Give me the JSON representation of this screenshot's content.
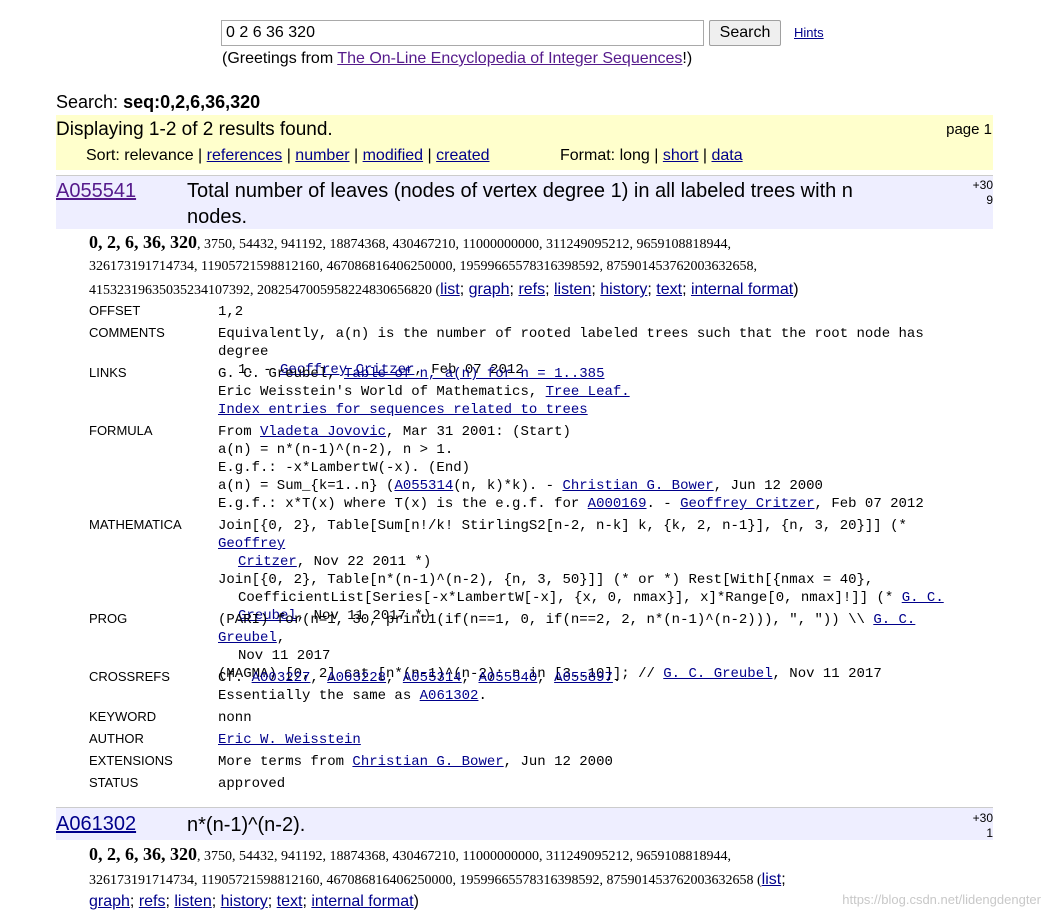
{
  "search": {
    "value": "0 2 6 36 320",
    "button": "Search",
    "hints": "Hints",
    "greeting_pre": "(Greetings from ",
    "greeting_link": "The On-Line Encyclopedia of Integer Sequences",
    "greeting_post": "!)"
  },
  "query": {
    "label": "Search:",
    "term": "seq:0,2,6,36,320"
  },
  "results": {
    "summary": "Displaying 1-2 of 2 results found.",
    "page": "page 1",
    "sort_label": "Sort: relevance",
    "sort_links": [
      "references",
      "number",
      "modified",
      "created"
    ],
    "format_label": "Format: long",
    "format_links": [
      "short",
      "data"
    ]
  },
  "seq_links": [
    "list",
    "graph",
    "refs",
    "listen",
    "history",
    "text",
    "internal format"
  ],
  "seq1": {
    "id": "A055541",
    "title": "Total number of leaves (nodes of vertex degree 1) in all labeled trees with n nodes.",
    "votes_top": "+30",
    "votes_bottom": "9",
    "first_terms": "0, 2, 6, 36, 320",
    "terms_rest1": ", 3750, 54432, 941192, 18874368, 430467210, 11000000000, 311249095212, 9659108818944,",
    "terms_rest2": "326173191714734, 11905721598812160, 467086816406250000, 19599665578316398592, 875901453762003632658,",
    "terms_rest3": "41532319635035234107392, 2082547005958224830656820 (",
    "offset_label": "OFFSET",
    "offset": "1,2",
    "comments_label": "COMMENTS",
    "comments_l1": "Equivalently, a(n) is the number of rooted labeled trees such that the root node has degree",
    "comments_l2": "1. - ",
    "comments_author": "Geoffrey Critzer",
    "comments_date": ", Feb 07 2012",
    "links_label": "LINKS",
    "links_l1_pre": "G. C. Greubel, ",
    "links_l1_link": "Table of n, a(n) for n = 1..385",
    "links_l2_pre": "Eric Weisstein's World of Mathematics, ",
    "links_l2_link": "Tree Leaf.",
    "links_l3_link": "Index entries for sequences related to trees",
    "formula_label": "FORMULA",
    "formula_l1_pre": "From ",
    "formula_l1_author": "Vladeta Jovovic",
    "formula_l1_post": ", Mar 31 2001: (Start)",
    "formula_l2": "a(n) = n*(n-1)^(n-2), n > 1.",
    "formula_l3": "E.g.f.: -x*LambertW(-x). (End)",
    "formula_l4_pre": "a(n) = Sum_{k=1..n} (",
    "formula_l4_link": "A055314",
    "formula_l4_mid": "(n, k)*k). - ",
    "formula_l4_author": "Christian G. Bower",
    "formula_l4_post": ", Jun 12 2000",
    "formula_l5_pre": "E.g.f.: x*T(x) where T(x) is the e.g.f. for ",
    "formula_l5_link": "A000169",
    "formula_l5_mid": ". - ",
    "formula_l5_author": "Geoffrey Critzer",
    "formula_l5_post": ", Feb 07 2012",
    "math_label": "MATHEMATICA",
    "math_l1": "Join[{0, 2}, Table[Sum[n!/k! StirlingS2[n-2, n-k] k, {k, 2, n-1}], {n, 3, 20}]] (* ",
    "math_l1_author": "Geoffrey",
    "math_l2_author": "Critzer",
    "math_l2_post": ", Nov 22 2011 *)",
    "math_l3": "Join[{0, 2}, Table[n*(n-1)^(n-2), {n, 3, 50}]] (* or *) Rest[With[{nmax = 40},",
    "math_l4": "CoefficientList[Series[-x*LambertW[-x], {x, 0, nmax}], x]*Range[0, nmax]!]] (* ",
    "math_l4_author": "G. C.",
    "math_l5_author": "Greubel",
    "math_l5_post": ", Nov 11 2017 *)",
    "prog_label": "PROG",
    "prog_l1": "(PARI) for(n=1, 30, print1(if(n==1, 0, if(n==2, 2, n*(n-1)^(n-2))), \", \")) \\\\ ",
    "prog_l1_author": "G. C. Greubel",
    "prog_l1_post": ",",
    "prog_l2": "Nov 11 2017",
    "prog_l3": "(MAGMA) [0, 2] cat [n*(n-1)^(n-2): n in [3..10]]; // ",
    "prog_l3_author": "G. C. Greubel",
    "prog_l3_post": ", Nov 11 2017",
    "xref_label": "CROSSREFS",
    "xref_pre": "Cf. ",
    "xref_links": [
      "A003227",
      "A003228",
      "A055314",
      "A055540",
      "A055897"
    ],
    "xref_l2_pre": "Essentially the same as ",
    "xref_l2_link": "A061302",
    "keyword_label": "KEYWORD",
    "keyword": "nonn",
    "author_label": "AUTHOR",
    "author": "Eric W. Weisstein",
    "ext_label": "EXTENSIONS",
    "ext_pre": "More terms from ",
    "ext_author": "Christian G. Bower",
    "ext_post": ", Jun 12 2000",
    "status_label": "STATUS",
    "status": "approved"
  },
  "seq2": {
    "id": "A061302",
    "title": "n*(n-1)^(n-2).",
    "votes_top": "+30",
    "votes_bottom": "1",
    "first_terms": "0, 2, 6, 36, 320",
    "terms_rest1": ", 3750, 54432, 941192, 18874368, 430467210, 11000000000, 311249095212, 9659108818944,",
    "terms_rest2": "326173191714734, 11905721598812160, 467086816406250000, 19599665578316398592, 875901453762003632658 ("
  },
  "watermark": "https://blog.csdn.net/lidengdengter"
}
